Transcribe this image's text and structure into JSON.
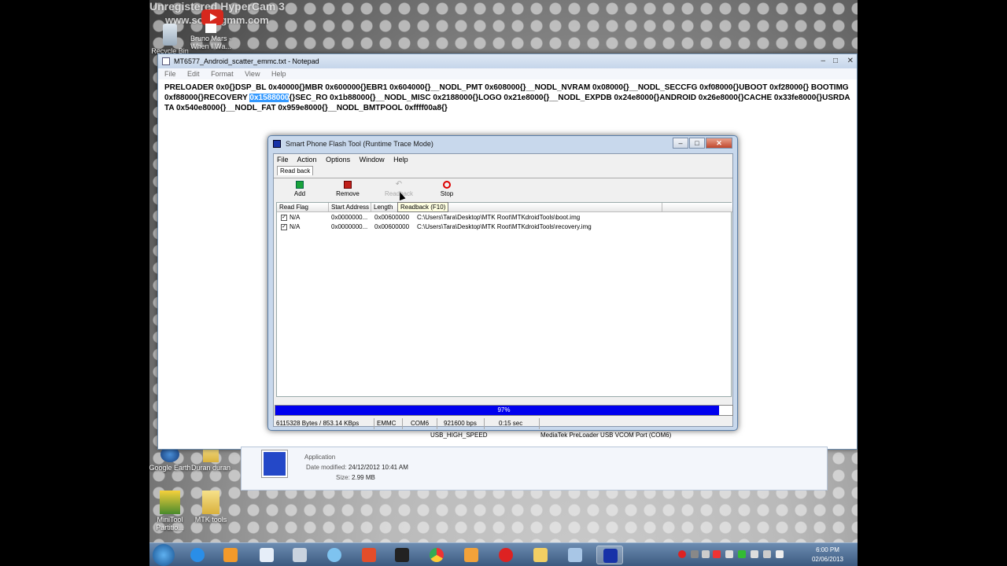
{
  "watermark": {
    "line1": "Unregistered HyperCam 3",
    "line2": "www.solveigmm.com"
  },
  "desktop_icons": [
    {
      "label": "Recycle Bin",
      "icon": "recycle-bin-icon"
    },
    {
      "label": "Bruno Mars - When I Wa...",
      "icon": "shortcut-icon"
    },
    {
      "label": "Google Earth",
      "icon": "google-earth-icon"
    },
    {
      "label": "Duran duran",
      "icon": "folder-icon"
    },
    {
      "label": "MiniTool Partitio...",
      "icon": "minitool-icon"
    },
    {
      "label": "MTK tools",
      "icon": "folder-icon"
    }
  ],
  "notepad": {
    "title": "MT6577_Android_scatter_emmc.txt - Notepad",
    "menu": [
      "File",
      "Edit",
      "Format",
      "View",
      "Help"
    ],
    "text_before": "PRELOADER 0x0{}DSP_BL 0x40000{}MBR 0x600000{}EBR1 0x604000{}__NODL_PMT 0x608000{}__NODL_NVRAM 0x08000{}__NODL_SECCFG 0xf08000{}UBOOT 0xf28000{} BOOTIMG 0xf88000{}RECOVERY ",
    "text_selected": "0x1588000",
    "text_after": "{}SEC_RO 0x1b88000{}__NODL_MISC 0x2188000{}LOGO 0x21e8000{}__NODL_EXPDB 0x24e8000{}ANDROID 0x26e8000{}CACHE 0x33fe8000{}USRDATA 0x540e8000{}__NODL_FAT 0x959e8000{}__NODL_BMTPOOL 0xffff00a8{}"
  },
  "flash_tool": {
    "title": "Smart Phone Flash Tool (Runtime Trace Mode)",
    "menu": [
      "File",
      "Action",
      "Options",
      "Window",
      "Help"
    ],
    "tab": "Read back",
    "toolbar": {
      "add": "Add",
      "remove": "Remove",
      "readback": "Readback",
      "stop": "Stop"
    },
    "tooltip": "Readback (F10)",
    "columns": [
      "Read Flag",
      "Start Address",
      "Length",
      "File Path"
    ],
    "rows": [
      {
        "flag": "N/A",
        "start": "0x0000000...",
        "length": "0x00600000",
        "path": "C:\\Users\\Tara\\Desktop\\MTK Root\\MTKdroidTools\\boot.img"
      },
      {
        "flag": "N/A",
        "start": "0x0000000...",
        "length": "0x00600000",
        "path": "C:\\Users\\Tara\\Desktop\\MTK Root\\MTKdroidTools\\recovery.img"
      }
    ],
    "progress_label": "97%",
    "progress_value": 0.97,
    "status": {
      "bytes": "6115328 Bytes / 853.14 KBps",
      "storage": "EMMC",
      "port": "COM6",
      "baud": "921600 bps",
      "time": "0:15 sec"
    },
    "status2": {
      "usb": "USB_HIGH_SPEED",
      "device": "MediaTek PreLoader USB VCOM Port (COM6)"
    }
  },
  "details": {
    "type": "Application",
    "date_label": "Date modified:",
    "date_value": "24/12/2012 10:41 AM",
    "size_label": "Size:",
    "size_value": "2.99 MB"
  },
  "clock": {
    "time": "6:00 PM",
    "date": "02/06/2013"
  }
}
